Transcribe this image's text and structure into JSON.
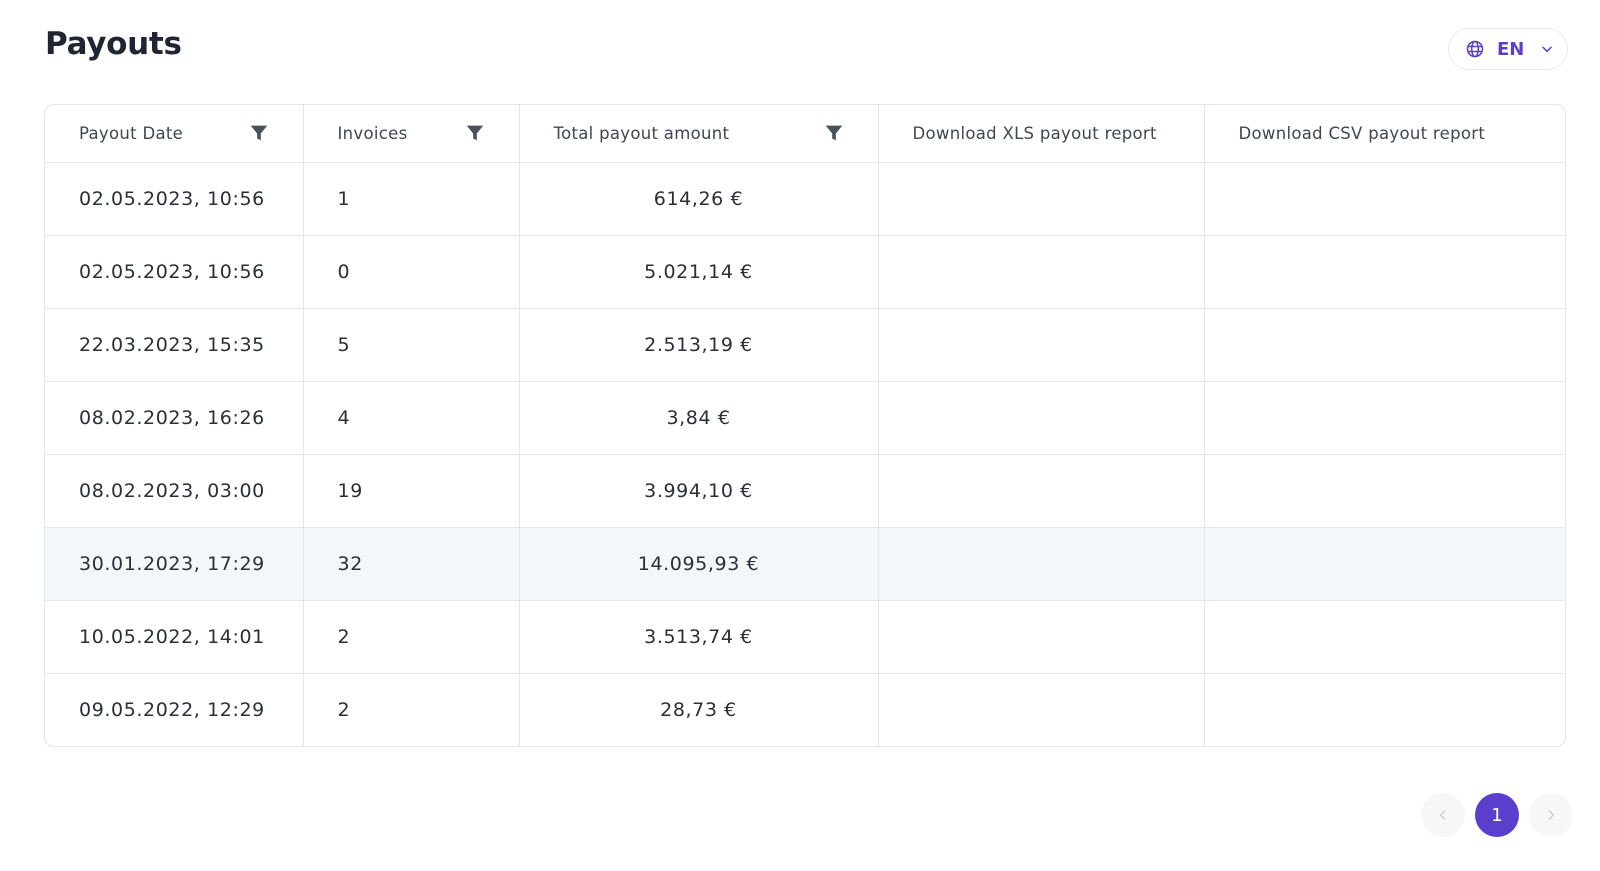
{
  "page": {
    "title": "Payouts"
  },
  "language": {
    "selected": "EN",
    "accent": "#5b3fcc"
  },
  "table": {
    "headers": [
      {
        "label": "Payout Date",
        "filterable": true
      },
      {
        "label": "Invoices",
        "filterable": true
      },
      {
        "label": "Total payout amount",
        "filterable": true
      },
      {
        "label": "Download XLS payout report",
        "filterable": false
      },
      {
        "label": "Download CSV payout report",
        "filterable": false
      }
    ],
    "rows": [
      {
        "date": "02.05.2023, 10:56",
        "invoices": "1",
        "amount": "614,26 €",
        "xls": "",
        "csv": ""
      },
      {
        "date": "02.05.2023, 10:56",
        "invoices": "0",
        "amount": "5.021,14 €",
        "xls": "",
        "csv": ""
      },
      {
        "date": "22.03.2023, 15:35",
        "invoices": "5",
        "amount": "2.513,19 €",
        "xls": "",
        "csv": ""
      },
      {
        "date": "08.02.2023, 16:26",
        "invoices": "4",
        "amount": "3,84 €",
        "xls": "",
        "csv": ""
      },
      {
        "date": "08.02.2023, 03:00",
        "invoices": "19",
        "amount": "3.994,10 €",
        "xls": "",
        "csv": ""
      },
      {
        "date": "30.01.2023, 17:29",
        "invoices": "32",
        "amount": "14.095,93 €",
        "xls": "",
        "csv": ""
      },
      {
        "date": "10.05.2022, 14:01",
        "invoices": "2",
        "amount": "3.513,74 €",
        "xls": "",
        "csv": ""
      },
      {
        "date": "09.05.2022, 12:29",
        "invoices": "2",
        "amount": "28,73 €",
        "xls": "",
        "csv": ""
      }
    ],
    "highlighted_row": 5
  },
  "pagination": {
    "current_page": "1",
    "prev_icon": "chevron-left-icon",
    "next_icon": "chevron-right-icon"
  }
}
